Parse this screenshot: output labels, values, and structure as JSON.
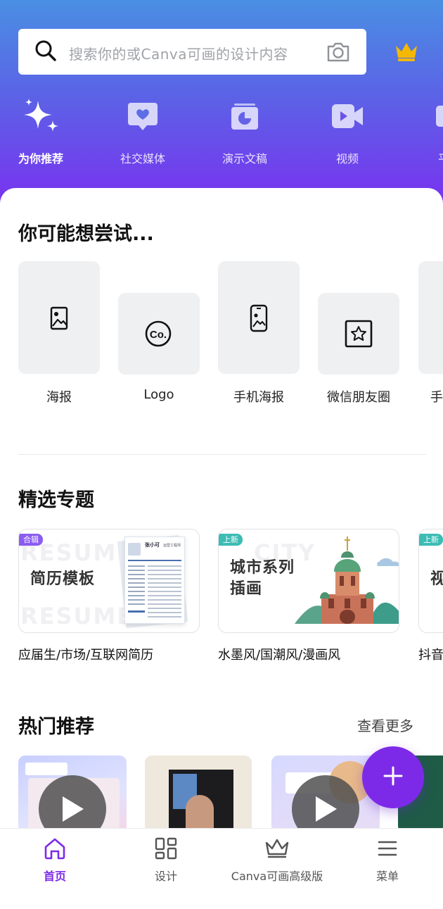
{
  "search": {
    "placeholder": "搜索你的或Canva可画的设计内容"
  },
  "categories": [
    {
      "label": "为你推荐",
      "icon": "sparkle-icon"
    },
    {
      "label": "社交媒体",
      "icon": "heart-chat-icon"
    },
    {
      "label": "演示文稿",
      "icon": "presentation-icon"
    },
    {
      "label": "视频",
      "icon": "video-icon"
    },
    {
      "label": "平面",
      "icon": "print-icon"
    }
  ],
  "try_section": {
    "title": "你可能想尝试...",
    "items": [
      {
        "label": "海报",
        "icon": "poster-icon"
      },
      {
        "label": "Logo",
        "icon": "logo-co-icon"
      },
      {
        "label": "手机海报",
        "icon": "phone-poster-icon"
      },
      {
        "label": "微信朋友圈",
        "icon": "star-frame-icon"
      },
      {
        "label": "手"
      }
    ]
  },
  "featured": {
    "title": "精选专题",
    "cards": [
      {
        "tag": "合辑",
        "title": "简历模板",
        "bg_word": "RESUME",
        "subtitle": "应届生/市场/互联网简历",
        "tag_color": "#8a5cf0"
      },
      {
        "tag": "上新",
        "title_line1": "城市系列",
        "title_line2": "插画",
        "bg_word": "CITY",
        "subtitle": "水墨风/国潮风/漫画风",
        "tag_color": "#3cbcb4"
      },
      {
        "tag": "上新",
        "title": "视",
        "subtitle": "抖音",
        "tag_color": "#3cbcb4"
      }
    ],
    "resume_preview": {
      "name": "张小可",
      "role": "运营工程师"
    }
  },
  "hot": {
    "title": "热门推荐",
    "see_more": "查看更多"
  },
  "tabs": [
    {
      "label": "首页",
      "icon": "home-icon",
      "active": true
    },
    {
      "label": "设计",
      "icon": "grid-icon",
      "active": false
    },
    {
      "label": "Canva可画高级版",
      "icon": "crown-outline-icon",
      "active": false
    },
    {
      "label": "菜单",
      "icon": "menu-icon",
      "active": false
    }
  ],
  "colors": {
    "brand": "#7d2ae8",
    "crown": "#f5b800"
  }
}
